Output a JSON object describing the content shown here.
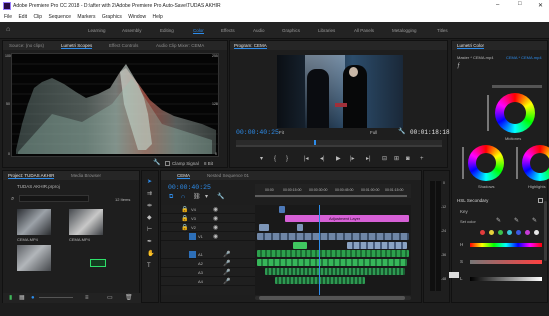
{
  "window": {
    "title": "Adobe Premiere Pro CC 2018 - D:\\after with 2\\Adobe Premiere Pro Auto-Save\\TUDAS AKHIR",
    "min": "–",
    "max": "□",
    "close": "✕"
  },
  "menu": [
    "File",
    "Edit",
    "Clip",
    "Sequence",
    "Markers",
    "Graphics",
    "Window",
    "Help"
  ],
  "workspaces": [
    "Learning",
    "Assembly",
    "Editing",
    "Color",
    "Effects",
    "Audio",
    "Graphics",
    "Libraries",
    "All Panels",
    "Metalogging",
    "Titles"
  ],
  "workspace_active": "Color",
  "scopes": {
    "tabs": [
      "Source: (no clips)",
      "Lumetri Scopes",
      "Effect Controls",
      "Audio Clip Mixer: CEMA"
    ],
    "active_tab": "Lumetri Scopes",
    "left_labels": [
      "100",
      "90",
      "80",
      "70",
      "60",
      "50",
      "40",
      "30",
      "20",
      "10",
      "0"
    ],
    "right_labels": [
      "255",
      "230",
      "204",
      "179",
      "153",
      "128",
      "102",
      "77",
      "51",
      "26",
      "0"
    ],
    "footer_clamp": "Clamp Signal",
    "footer_bits": "8 Bit"
  },
  "program": {
    "tab": "Program: CEMA",
    "timecode": "00:00:40:25",
    "fit": "Fit",
    "quality": "Full",
    "duration": "00:01:18:18"
  },
  "lumetri": {
    "tab": "Lumetri Color",
    "master": "Master * CEMA.mp4",
    "sequence": "CEMA * CEMA.mp4",
    "wheels": [
      "Midtones",
      "Shadows",
      "Highlights"
    ],
    "hsl": "HSL Secondary",
    "key": "Key",
    "set_color": "Set color",
    "hsl_letters": [
      "H",
      "S",
      "L"
    ]
  },
  "project": {
    "tabs": [
      "Project: TUDAS AKHIR",
      "Media Browser"
    ],
    "file": "TUDAS AKHIR.prproj",
    "items_count": "12 Items",
    "clips": [
      "CEMA.MP4",
      "CEMA.MP4"
    ]
  },
  "timeline": {
    "tabs": [
      "CEMA",
      "Nested Sequence 01"
    ],
    "timecode": "00:00:40:25",
    "ruler": [
      "00:00",
      "00:00:15:00",
      "00:00:30:00",
      "00:00:45:00",
      "00:01:00:00",
      "00:01:15:00"
    ],
    "video_tracks": [
      "V4",
      "V3",
      "V2",
      "V1"
    ],
    "audio_tracks": [
      "A1",
      "A2",
      "A3",
      "A4"
    ],
    "adjustment_label": "Adjustment Layer",
    "meter_labels": [
      "0",
      "-6",
      "-12",
      "-18",
      "-24",
      "-30",
      "-36",
      "-42",
      "-48",
      "-54"
    ]
  }
}
